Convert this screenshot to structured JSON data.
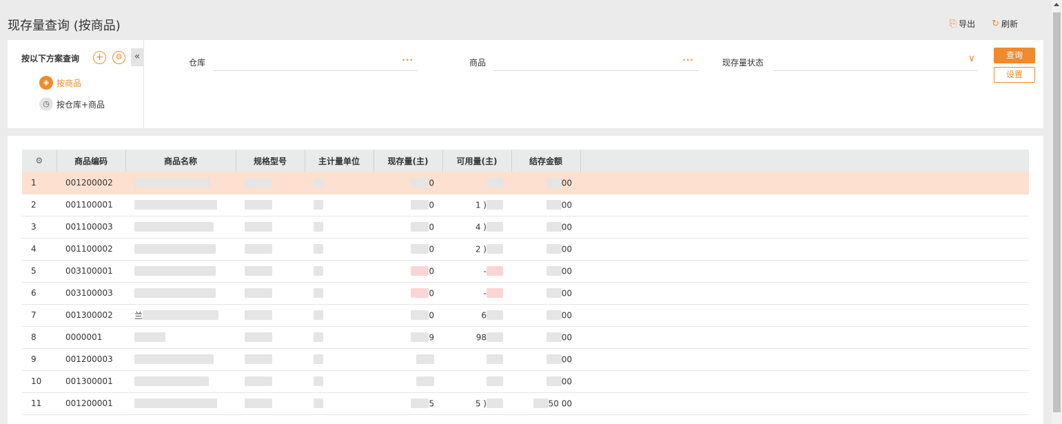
{
  "page": {
    "title": "现存量查询 (按商品)"
  },
  "top_actions": {
    "export_label": "导出",
    "refresh_label": "刷新"
  },
  "scheme": {
    "title": "按以下方案查询",
    "items": [
      {
        "label": "按商品",
        "active": true
      },
      {
        "label": "按仓库+商品",
        "active": false
      }
    ]
  },
  "filters": {
    "warehouse_label": "仓库",
    "product_label": "商品",
    "status_label": "现存量状态",
    "query_button": "查询",
    "settings_button": "设置"
  },
  "table": {
    "columns": [
      "商品编码",
      "商品名称",
      "规格型号",
      "主计量单位",
      "现存量(主)",
      "可用量(主)",
      "结存金额"
    ],
    "rows": [
      {
        "idx": "1",
        "code": "001200002",
        "qty_tail": "0",
        "avail_tail": "",
        "amount_tail": "00",
        "selected": true
      },
      {
        "idx": "2",
        "code": "001100001",
        "qty_tail": "0",
        "avail_tail": "1 )",
        "amount_tail": "00"
      },
      {
        "idx": "3",
        "code": "001100003",
        "qty_tail": "0",
        "avail_tail": "4 )",
        "amount_tail": "00"
      },
      {
        "idx": "4",
        "code": "001100002",
        "qty_tail": "0",
        "avail_tail": "2 )",
        "amount_tail": "00"
      },
      {
        "idx": "5",
        "code": "003100001",
        "qty_tail": "0",
        "avail_tail": "-",
        "amount_tail": "00",
        "negative": true
      },
      {
        "idx": "6",
        "code": "003100003",
        "qty_tail": "0",
        "avail_tail": "-",
        "amount_tail": "00",
        "negative": true
      },
      {
        "idx": "7",
        "code": "001300002",
        "name_head": "兰",
        "qty_tail": "0",
        "avail_tail": "6",
        "amount_tail": "00"
      },
      {
        "idx": "8",
        "code": "0000001",
        "qty_tail": "9",
        "avail_tail": "98",
        "amount_tail": "00"
      },
      {
        "idx": "9",
        "code": "001200003",
        "qty_tail": "",
        "avail_tail": "",
        "amount_tail": "00"
      },
      {
        "idx": "10",
        "code": "001300001",
        "qty_tail": "",
        "avail_tail": "",
        "amount_tail": "00"
      },
      {
        "idx": "11",
        "code": "001200001",
        "qty_tail": "5",
        "avail_tail": "5 )",
        "amount_tail": "50 00"
      }
    ]
  }
}
